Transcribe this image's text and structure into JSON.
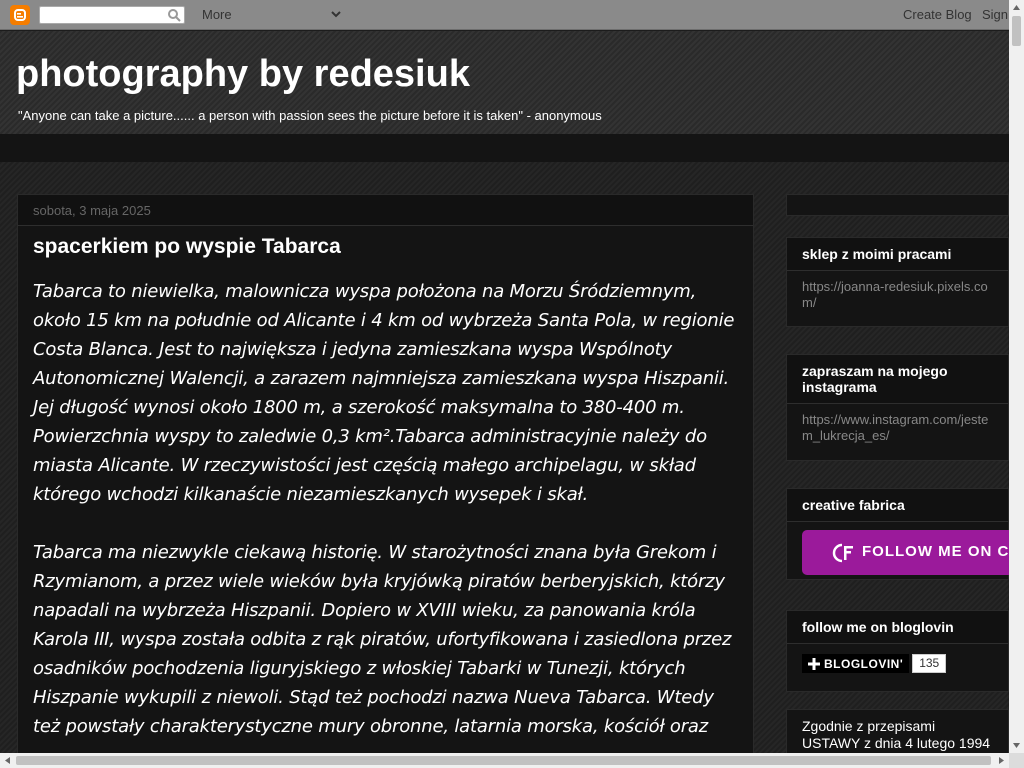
{
  "navbar": {
    "more_label": "More",
    "create_blog": "Create Blog",
    "sign_in": "Sign In"
  },
  "header": {
    "title": "photography by redesiuk",
    "description": "\"Anyone can take a picture...... a person with passion sees the picture before it is taken\" - anonymous"
  },
  "post": {
    "date": "sobota, 3 maja 2025",
    "title": "spacerkiem po wyspie Tabarca",
    "paragraphs": [
      "Tabarca to niewielka, malownicza wyspa położona na Morzu Śródziemnym, około 15 km na południe od Alicante i 4 km od wybrzeża Santa Pola, w regionie Costa Blanca. Jest to największa i jedyna zamieszkana wyspa Wspólnoty Autonomicznej Walencji, a zarazem najmniejsza zamieszkana wyspa Hiszpanii. Jej długość wynosi około 1800 m, a szerokość maksymalna to 380-400 m. Powierzchnia wyspy to zaledwie 0,3 km².Tabarca administracyjnie należy do miasta Alicante. W rzeczywistości jest częścią małego archipelagu, w skład którego wchodzi kilkanaście niezamieszkanych wysepek i skał.",
      "Tabarca ma niezwykle ciekawą historię. W starożytności znana była Grekom i Rzymianom, a przez wiele wieków była kryjówką piratów berberyjskich, którzy napadali na wybrzeża Hiszpanii. Dopiero w XVIII wieku, za panowania króla Karola III, wyspa została odbita z rąk piratów, ufortyfikowana i zasiedlona przez osadników pochodzenia liguryjskiego z włoskiej Tabarki w Tunezji, których Hiszpanie wykupili z niewoli. Stąd też pochodzi nazwa Nueva Tabarca. Wtedy też powstały charakterystyczne mury obronne, latarnia morska, kościół oraz"
    ]
  },
  "sidebar": {
    "shop_title": "sklep z moimi pracami",
    "shop_link": "https://joanna-redesiuk.pixels.com/",
    "instagram_title": "zapraszam na mojego instagrama",
    "instagram_link": "https://www.instagram.com/jestem_lukrecja_es/",
    "fabrica_title": "creative fabrica",
    "follow_label": "FOLLOW ME ON CREATIVE FABRICA",
    "bloglovin_title": "follow me on bloglovin",
    "bloglovin_label": "BLOGLOVIN'",
    "bloglovin_count": "135",
    "law_text": "Zgodnie z przepisami USTAWY z dnia 4 lutego 1994"
  },
  "colors": {
    "background": "#1c1c1c",
    "follow_button": "#9b1a9b",
    "blogger_orange": "#f57d00"
  }
}
